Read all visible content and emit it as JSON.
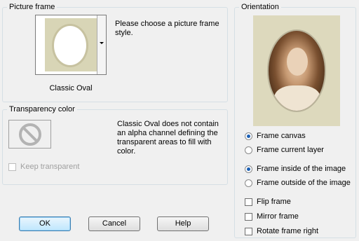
{
  "picture_frame": {
    "title": "Picture frame",
    "selected_frame": "Classic Oval",
    "prompt": "Please choose a picture frame style."
  },
  "transparency": {
    "title": "Transparency color",
    "message": "Classic Oval does not contain an alpha channel defining the transparent areas to fill with color.",
    "keep_transparent_label": "Keep transparent"
  },
  "orientation": {
    "title": "Orientation",
    "options": {
      "frame_canvas": "Frame canvas",
      "frame_current_layer": "Frame current layer",
      "frame_inside": "Frame inside of the image",
      "frame_outside": "Frame outside of the image"
    },
    "checkboxes": {
      "flip_frame": "Flip frame",
      "mirror_frame": "Mirror frame",
      "rotate_frame_right": "Rotate frame right"
    }
  },
  "buttons": {
    "ok": "OK",
    "cancel": "Cancel",
    "help": "Help"
  },
  "colors": {
    "frame_mat": "#d8d5b6",
    "radio_selected": "#1a5fb4"
  },
  "icons": {
    "no_transparency": "no-sign-icon",
    "dropdown": "chevron-down-icon"
  }
}
